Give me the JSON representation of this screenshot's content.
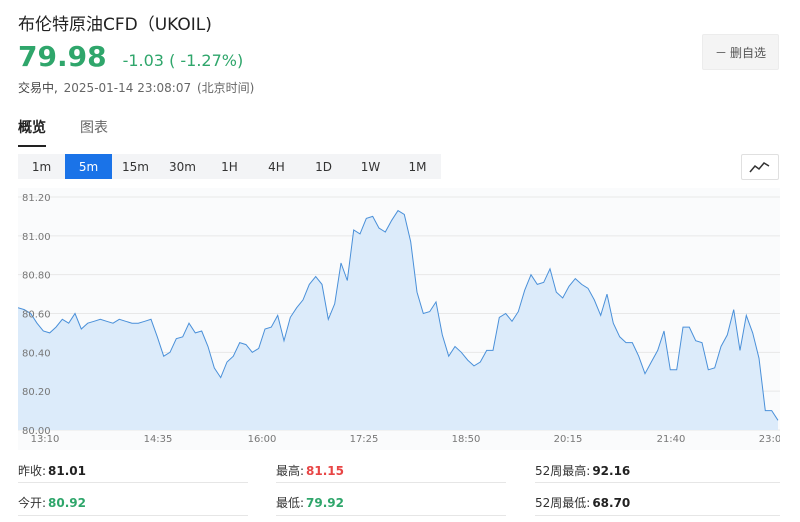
{
  "header": {
    "title": "布伦特原油CFD（UKOIL)",
    "price": "79.98",
    "change": "-1.03 ( -1.27%)",
    "status_label": "交易中,",
    "timestamp": "2025-01-14 23:08:07",
    "timezone_note": "(北京时间)"
  },
  "watchlist_button": {
    "label": "删自选"
  },
  "tabs": [
    "概览",
    "图表"
  ],
  "intervals": [
    "1m",
    "5m",
    "15m",
    "30m",
    "1H",
    "4H",
    "1D",
    "1W",
    "1M"
  ],
  "active_interval": "5m",
  "colors": {
    "accent": "#1a73e8",
    "up": "#e84545",
    "down": "#2fa66b",
    "line": "#4a90d9",
    "fill": "#dcebfa"
  },
  "chart_data": {
    "type": "area",
    "ylim": [
      80.0,
      81.2
    ],
    "y_ticks": [
      "81.20",
      "81.00",
      "80.80",
      "80.60",
      "80.40",
      "80.20",
      "80.00"
    ],
    "x_ticks": [
      "13:10",
      "14:35",
      "16:00",
      "17:25",
      "18:50",
      "20:15",
      "21:40",
      "23:0"
    ],
    "grid": true,
    "y": [
      80.63,
      80.62,
      80.6,
      80.55,
      80.51,
      80.5,
      80.53,
      80.57,
      80.55,
      80.6,
      80.52,
      80.55,
      80.56,
      80.57,
      80.56,
      80.55,
      80.57,
      80.56,
      80.55,
      80.55,
      80.56,
      80.57,
      80.48,
      80.38,
      80.4,
      80.47,
      80.48,
      80.55,
      80.5,
      80.51,
      80.43,
      80.32,
      80.27,
      80.35,
      80.38,
      80.45,
      80.44,
      80.4,
      80.42,
      80.52,
      80.53,
      80.59,
      80.46,
      80.58,
      80.63,
      80.67,
      80.75,
      80.79,
      80.75,
      80.57,
      80.65,
      80.86,
      80.77,
      81.03,
      81.01,
      81.09,
      81.1,
      81.04,
      81.02,
      81.08,
      81.13,
      81.11,
      80.97,
      80.71,
      80.6,
      80.61,
      80.66,
      80.49,
      80.38,
      80.43,
      80.4,
      80.36,
      80.33,
      80.35,
      80.41,
      80.41,
      80.58,
      80.6,
      80.56,
      80.61,
      80.72,
      80.8,
      80.75,
      80.76,
      80.83,
      80.71,
      80.68,
      80.74,
      80.78,
      80.75,
      80.73,
      80.67,
      80.59,
      80.7,
      80.55,
      80.48,
      80.45,
      80.45,
      80.38,
      80.29,
      80.35,
      80.41,
      80.51,
      80.31,
      80.31,
      80.53,
      80.53,
      80.46,
      80.45,
      80.31,
      80.32,
      80.43,
      80.49,
      80.62,
      80.41,
      80.59,
      80.5,
      80.37,
      80.1,
      80.1,
      80.05
    ]
  },
  "stats": {
    "prev_close_label": "昨收:",
    "prev_close": "81.01",
    "open_label": "今开:",
    "open": "80.92",
    "high_label": "最高:",
    "high": "81.15",
    "low_label": "最低:",
    "low": "79.92",
    "high52_label": "52周最高:",
    "high52": "92.16",
    "low52_label": "52周最低:",
    "low52": "68.70"
  }
}
